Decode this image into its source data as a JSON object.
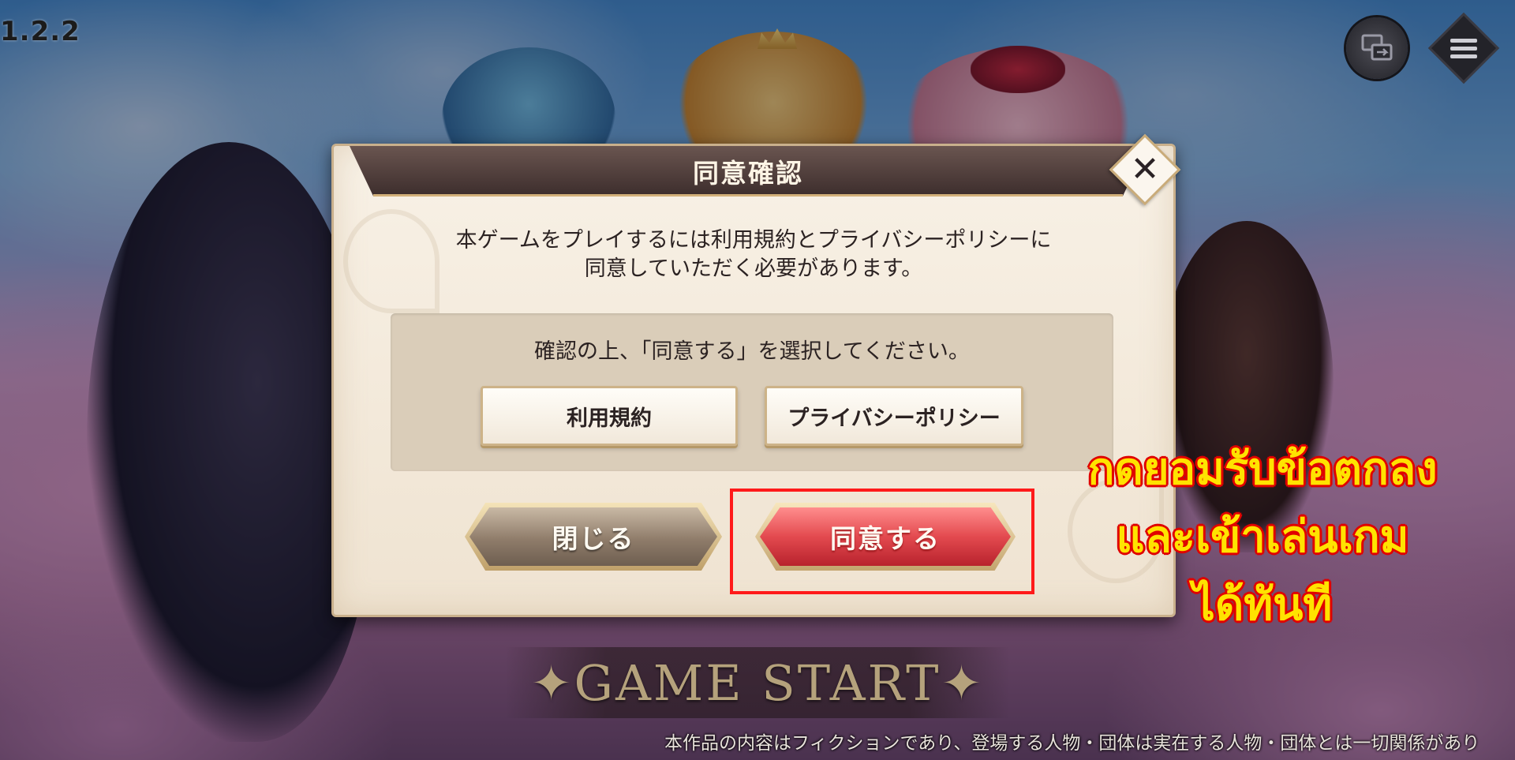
{
  "hud": {
    "version": "1.2.2",
    "switch_icon": "account-switch-icon",
    "menu_icon": "hamburger-menu-icon"
  },
  "dialog": {
    "title": "同意確認",
    "close_icon": "close-icon",
    "close_glyph": "✕",
    "description_line1": "本ゲームをプレイするには利用規約とプライバシーポリシーに",
    "description_line2": "同意していただく必要があります。",
    "instruction": "確認の上、「同意する」を選択してください。",
    "terms_button": "利用規約",
    "privacy_button": "プライバシーポリシー",
    "close_button": "閉じる",
    "agree_button": "同意する"
  },
  "annotation": {
    "line1": "กดยอมรับข้อตกลง",
    "line2": "และเข้าเล่นเกม",
    "line3": "ได้ทันที",
    "highlight_color": "#ff1a1a",
    "text_color": "#ffe300",
    "outline_color": "#e00000"
  },
  "screen": {
    "game_start": "✦GAME START✦",
    "disclaimer": "本作品の内容はフィクションであり、登場する人物・団体は実在する人物・団体とは一切関係があり"
  }
}
